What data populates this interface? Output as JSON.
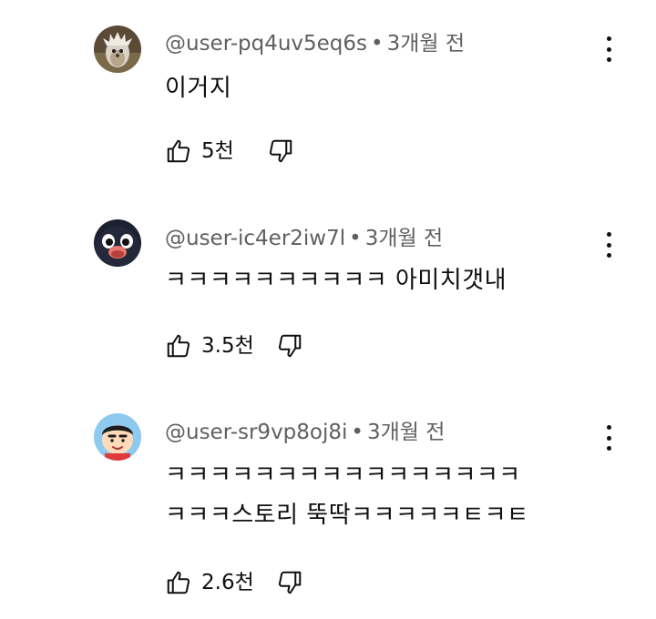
{
  "comments": [
    {
      "author": "@user-pq4uv5eq6s",
      "separator": "•",
      "time": "3개월 전",
      "lines": [
        "이거지"
      ],
      "likes": "5천",
      "avatar_icon": "hedgehog-avatar-icon"
    },
    {
      "author": "@user-ic4er2iw7l",
      "separator": "•",
      "time": "3개월 전",
      "lines": [
        "ㅋㅋㅋㅋㅋㅋㅋㅋㅋㅋ 아미치갯내"
      ],
      "likes": "3.5천",
      "avatar_icon": "penguin-avatar-icon"
    },
    {
      "author": "@user-sr9vp8oj8i",
      "separator": "•",
      "time": "3개월 전",
      "lines": [
        "ㅋㅋㅋㅋㅋㅋㅋㅋㅋㅋㅋㅋㅋㅋㅋㅋ",
        "ㅋㅋㅋ스토리 뚝딱ㅋㅋㅋㅋㅋㅌㅋㅌ"
      ],
      "likes": "2.6천",
      "avatar_icon": "cartoon-boy-avatar-icon"
    }
  ],
  "colors": {
    "text_primary": "#0f0f0f",
    "text_secondary": "#606060",
    "background": "#ffffff"
  }
}
